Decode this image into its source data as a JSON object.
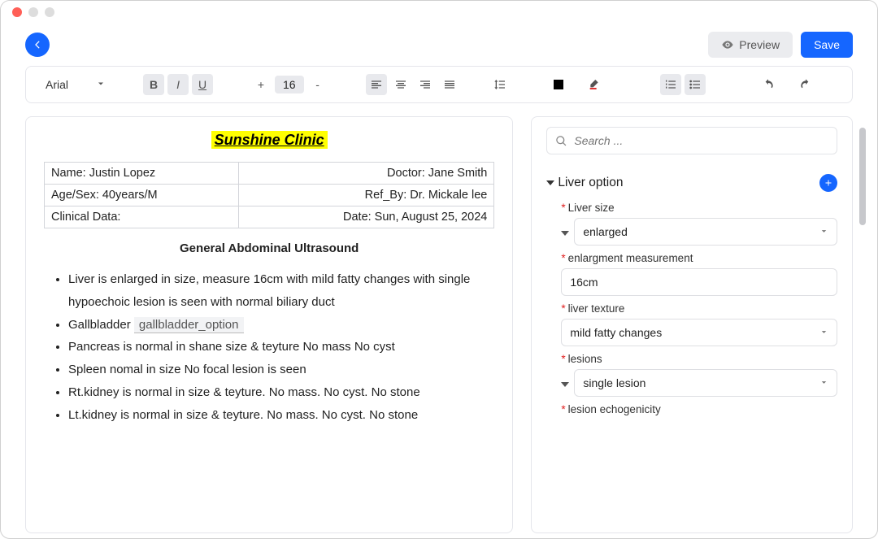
{
  "actions": {
    "preview": "Preview",
    "save": "Save"
  },
  "toolbar": {
    "font_family": "Arial",
    "font_size": "16"
  },
  "doc": {
    "clinic_title": "Sunshine Clinic",
    "table": {
      "r1c1": "Name: Justin Lopez",
      "r1c2": "Doctor: Jane Smith",
      "r2c1": "Age/Sex: 40years/M",
      "r2c2": "Ref_By: Dr. Mickale lee",
      "r3c1": "Clinical Data:",
      "r3c2": "Date: Sun, August 25, 2024"
    },
    "section_title": "General Abdominal Ultrasound",
    "bullets": {
      "b1": "Liver is enlarged in size, measure 16cm with mild fatty changes with single hypoechoic lesion is seen with normal biliary duct",
      "b2_prefix": "Gallbladder ",
      "b2_ph": "gallbladder_option",
      "b3": "Pancreas is normal in shane size & teyture No mass No cyst",
      "b4": "Spleen nomal in size No focal lesion is seen",
      "b5": " Rt.kidney is normal in size & teyture. No mass. No cyst. No stone",
      "b6": " Lt.kidney is normal in size & teyture. No mass. No cyst. No stone"
    }
  },
  "side": {
    "search_placeholder": "Search ...",
    "section_title": "Liver option",
    "fields": {
      "liver_size": {
        "label": "Liver size",
        "value": "enlarged"
      },
      "enlargement": {
        "label": "enlargment measurement",
        "value": "16cm"
      },
      "texture": {
        "label": "liver texture",
        "value": "mild fatty changes"
      },
      "lesions": {
        "label": "lesions",
        "value": "single lesion"
      },
      "echo": {
        "label": "lesion echogenicity"
      }
    }
  }
}
